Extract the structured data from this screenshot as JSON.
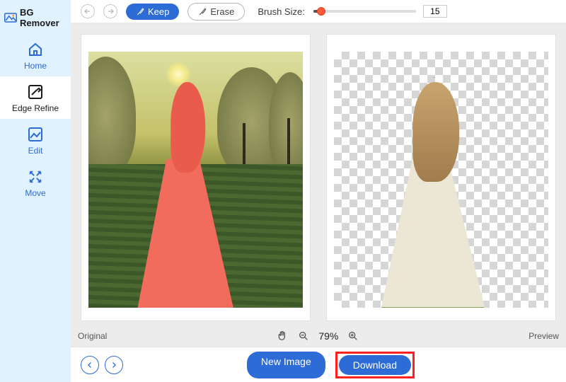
{
  "brand": {
    "name": "BG Remover"
  },
  "sidebar": {
    "items": [
      {
        "label": "Home"
      },
      {
        "label": "Edge Refine"
      },
      {
        "label": "Edit"
      },
      {
        "label": "Move"
      }
    ]
  },
  "toolbar": {
    "keep_label": "Keep",
    "erase_label": "Erase",
    "brush_label": "Brush Size:",
    "brush_value": "15"
  },
  "status": {
    "left_label": "Original",
    "right_label": "Preview",
    "zoom": "79%"
  },
  "footer": {
    "new_image": "New Image",
    "download": "Download"
  },
  "colors": {
    "accent": "#2d6bd6",
    "highlight": "#ff2020",
    "keep_mask": "#f26c5d"
  }
}
